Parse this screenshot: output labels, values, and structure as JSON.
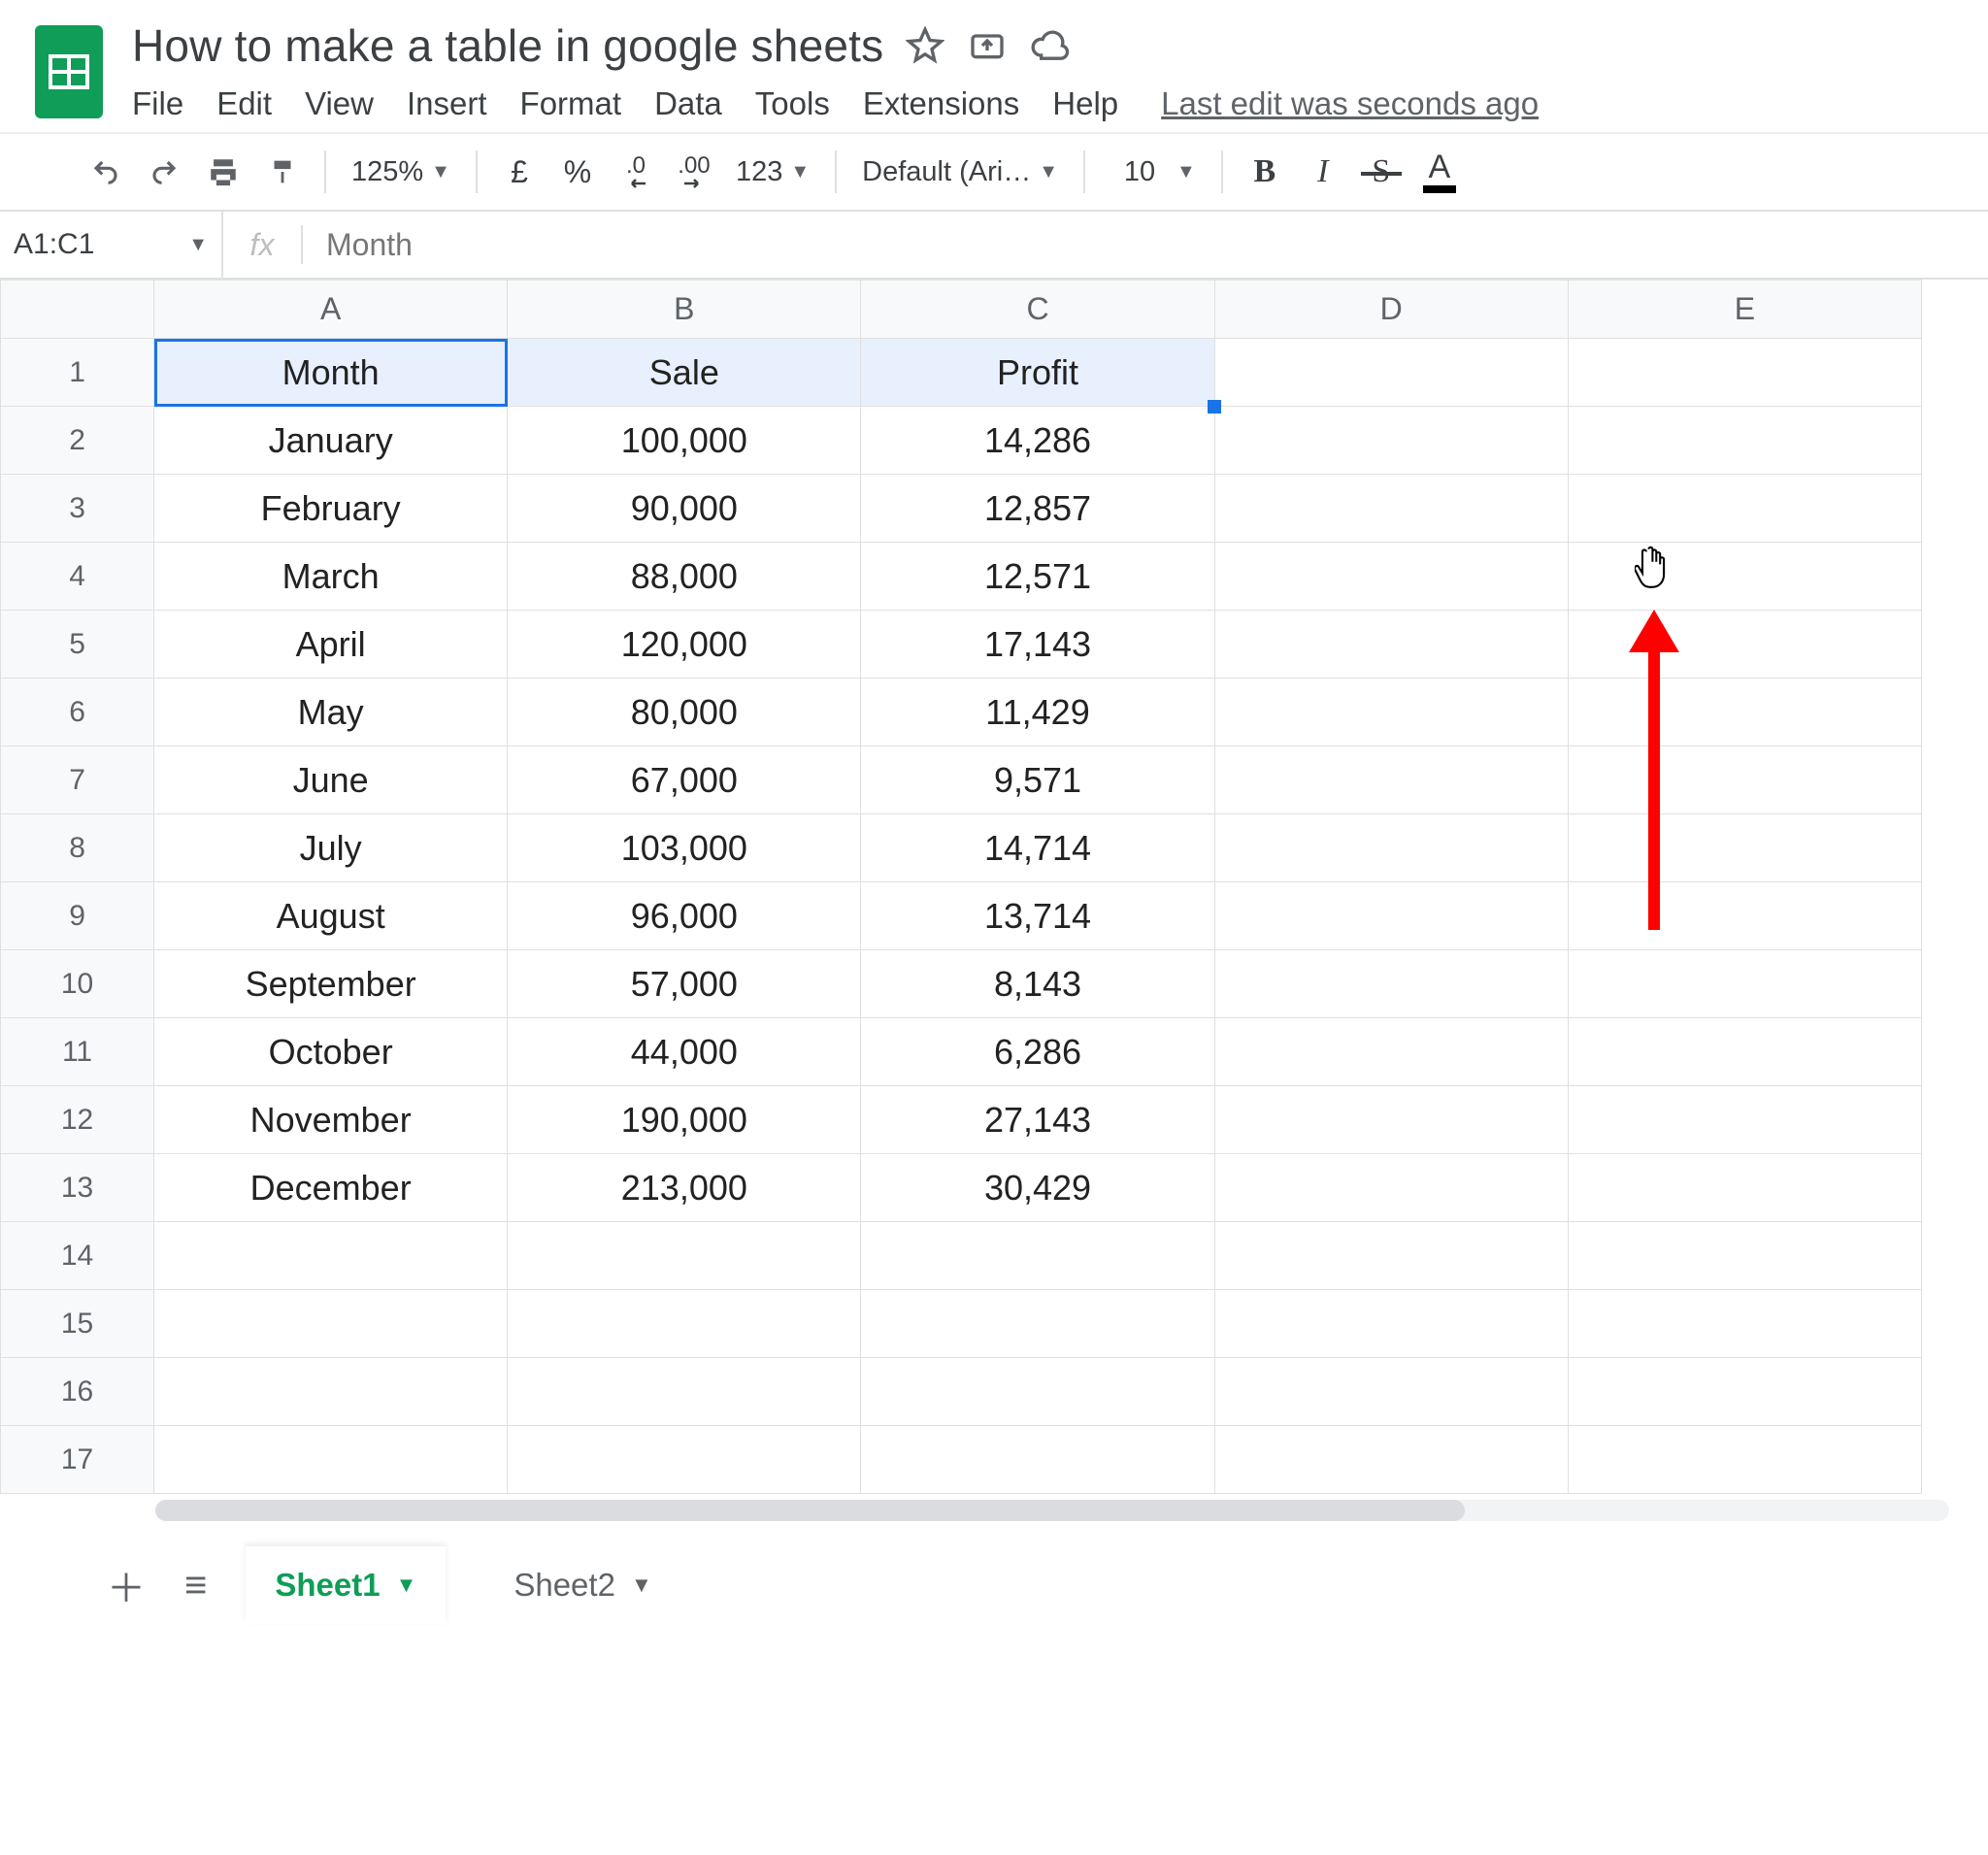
{
  "doc": {
    "title": "How to make a table in google sheets"
  },
  "menu": {
    "items": [
      "File",
      "Edit",
      "View",
      "Insert",
      "Format",
      "Data",
      "Tools",
      "Extensions",
      "Help"
    ],
    "last_edit": "Last edit was seconds ago"
  },
  "toolbar": {
    "zoom": "125%",
    "currency_symbol": "£",
    "percent_symbol": "%",
    "dec_less": ".0",
    "dec_more": ".00",
    "number_format": "123",
    "font_name": "Default (Ari…",
    "font_size": "10",
    "bold": "B",
    "italic": "I",
    "strike": "S",
    "textcolor": "A"
  },
  "fx": {
    "range": "A1:C1",
    "value": "Month"
  },
  "columns": [
    "A",
    "B",
    "C",
    "D",
    "E"
  ],
  "rows": [
    "1",
    "2",
    "3",
    "4",
    "5",
    "6",
    "7",
    "8",
    "9",
    "10",
    "11",
    "12",
    "13",
    "14",
    "15",
    "16",
    "17"
  ],
  "selection": {
    "active": "A1",
    "range_cols": [
      "A",
      "B",
      "C"
    ],
    "row": "1"
  },
  "chart_data": {
    "type": "table",
    "headers": [
      "Month",
      "Sale",
      "Profit"
    ],
    "rows": [
      [
        "January",
        "100,000",
        "14,286"
      ],
      [
        "February",
        "90,000",
        "12,857"
      ],
      [
        "March",
        "88,000",
        "12,571"
      ],
      [
        "April",
        "120,000",
        "17,143"
      ],
      [
        "May",
        "80,000",
        "11,429"
      ],
      [
        "June",
        "67,000",
        "9,571"
      ],
      [
        "July",
        "103,000",
        "14,714"
      ],
      [
        "August",
        "96,000",
        "13,714"
      ],
      [
        "September",
        "57,000",
        "8,143"
      ],
      [
        "October",
        "44,000",
        "6,286"
      ],
      [
        "November",
        "190,000",
        "27,143"
      ],
      [
        "December",
        "213,000",
        "30,429"
      ]
    ]
  },
  "tabs": {
    "active": "Sheet1",
    "other": "Sheet2"
  }
}
